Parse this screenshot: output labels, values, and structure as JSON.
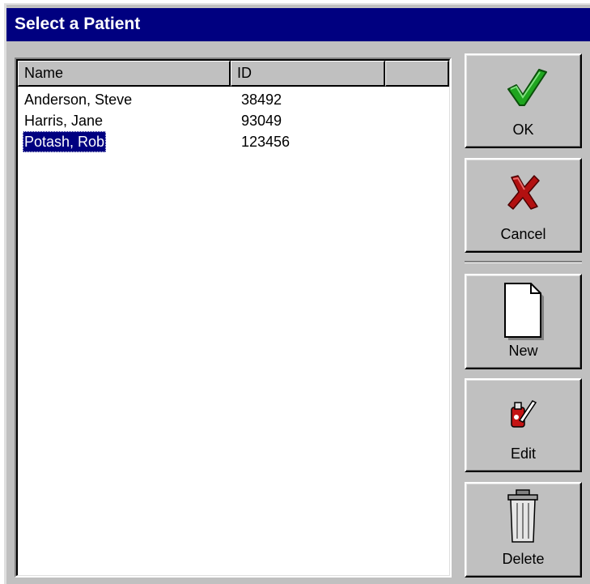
{
  "window": {
    "title": "Select a Patient"
  },
  "list": {
    "columns": [
      "Name",
      "ID",
      ""
    ],
    "rows": [
      {
        "name": "Anderson, Steve",
        "id": "38492"
      },
      {
        "name": "Harris, Jane",
        "id": "93049"
      },
      {
        "name": "Potash, Rob",
        "id": "123456",
        "selected": true
      }
    ]
  },
  "buttons": {
    "ok": {
      "label": "OK",
      "icon": "checkmark-icon"
    },
    "cancel": {
      "label": "Cancel",
      "icon": "red-x-icon"
    },
    "new": {
      "label": "New",
      "icon": "blank-page-icon"
    },
    "edit": {
      "label": "Edit",
      "icon": "pencil-eraser-icon"
    },
    "delete": {
      "label": "Delete",
      "icon": "trash-can-icon"
    }
  },
  "colors": {
    "titlebar": "#000080",
    "face": "#c0c0c0",
    "selection": "#000080",
    "check_green": "#1fa51f",
    "cancel_red": "#b21010"
  }
}
